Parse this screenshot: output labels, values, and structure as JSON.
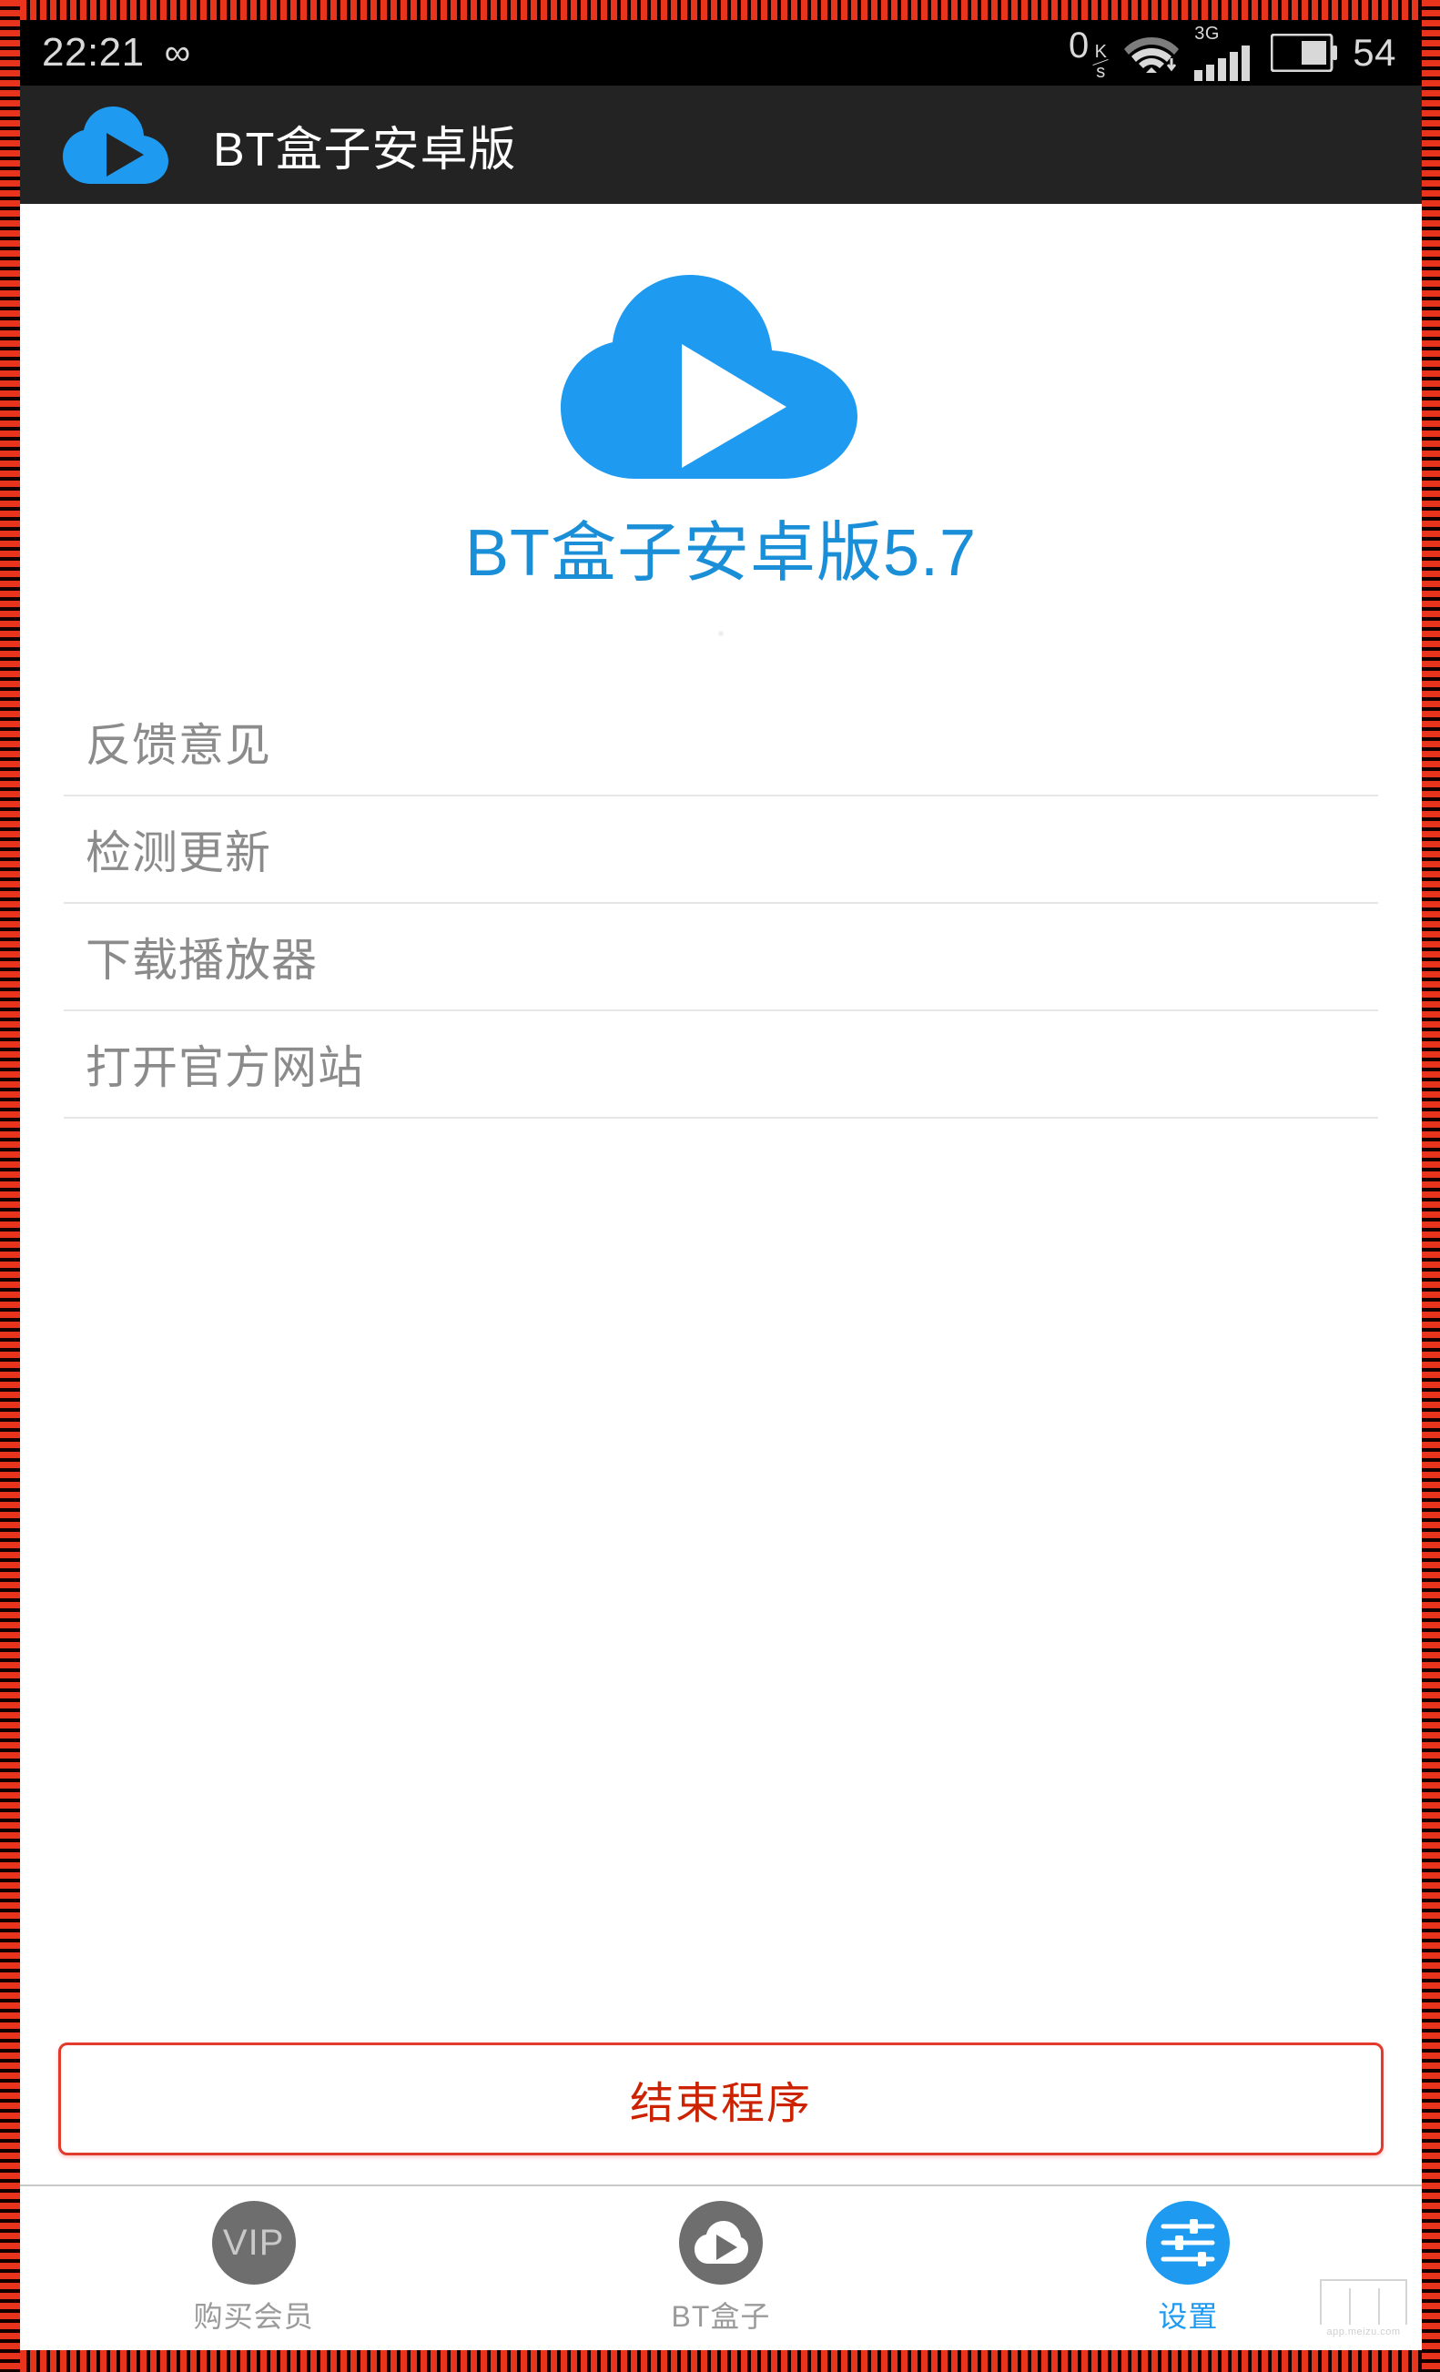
{
  "colors": {
    "brand_blue": "#1e9af0",
    "title_blue": "#1a8fd8",
    "exit_red": "#cc2200",
    "exit_border_red": "#e23b2e",
    "header_bg": "#232323",
    "status_bg": "#000000",
    "list_text_gray": "#8b8b8b",
    "nav_inactive_gray": "#6e6e6e",
    "frame_stripe_red": "#e8331d"
  },
  "status_bar": {
    "time": "22:21",
    "infinity_icon": "infinity-icon",
    "infinity_glyph": "∞",
    "net_speed_value": "0",
    "net_speed_unit_top": "K",
    "net_speed_unit_bottom": "s",
    "net_speed_unit": "K/s",
    "wifi_icon": "wifi-download-icon",
    "signal_label": "3G",
    "signal_icon": "signal-bars-icon",
    "battery_icon": "battery-icon",
    "battery_percent": "54"
  },
  "app_header": {
    "logo_icon": "cloud-play-logo-icon",
    "title": "BT盒子安卓版"
  },
  "main": {
    "logo_icon": "cloud-play-logo-large-icon",
    "version_title": "BT盒子安卓版5.7"
  },
  "settings_list": {
    "items": [
      {
        "label": "反馈意见",
        "name": "feedback"
      },
      {
        "label": "检测更新",
        "name": "check-update"
      },
      {
        "label": "下载播放器",
        "name": "download-player"
      },
      {
        "label": "打开官方网站",
        "name": "open-official-website"
      }
    ]
  },
  "exit_button": {
    "label": "结束程序"
  },
  "bottom_nav": {
    "items": [
      {
        "label": "购买会员",
        "icon": "vip-badge-icon",
        "icon_text": "VIP",
        "active": false
      },
      {
        "label": "BT盒子",
        "icon": "cloud-play-icon",
        "icon_text": "",
        "active": false
      },
      {
        "label": "设置",
        "icon": "settings-sliders-icon",
        "icon_text": "",
        "active": true
      }
    ]
  },
  "watermark": {
    "text": "app.meizu.com",
    "icon": "meizu-logo-icon"
  }
}
